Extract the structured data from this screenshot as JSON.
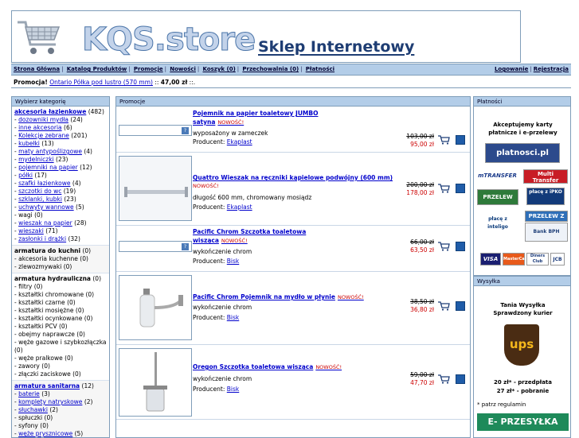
{
  "header": {
    "brand": "KQS.store",
    "tagline": "Sklep Internetowy"
  },
  "nav": {
    "items": [
      "Strona Główna",
      "Katalog Produktów",
      "Promocje",
      "Nowości",
      "Koszyk (0)",
      "Przechowalnia (0)",
      "Płatności"
    ],
    "right": [
      "Logowanie",
      "Rejestracja"
    ]
  },
  "promo_bar": {
    "label": "Promocja!",
    "link": "Ontario Półka pod lustro (570 mm)",
    "price": "47,00 zł"
  },
  "left": {
    "title": "Wybierz kategorię",
    "groups": [
      {
        "head": "akcesoria łazienkowe",
        "count": "(482)",
        "items": [
          {
            "name": "dozowniki mydła",
            "count": "(24)",
            "link": true
          },
          {
            "name": "inne akcesoria",
            "count": "(6)",
            "link": true
          },
          {
            "name": "Kolekcje zebrane",
            "count": "(201)",
            "link": true
          },
          {
            "name": "kubełki",
            "count": "(13)",
            "link": true
          },
          {
            "name": "maty antypoślizgowe",
            "count": "(4)",
            "link": true
          },
          {
            "name": "mydelniczki",
            "count": "(23)",
            "link": true
          },
          {
            "name": "pojemniki na papier",
            "count": "(12)",
            "link": true
          },
          {
            "name": "półki",
            "count": "(17)",
            "link": true
          },
          {
            "name": "szafki łazienkowe",
            "count": "(4)",
            "link": true
          },
          {
            "name": "szczotki do wc",
            "count": "(19)",
            "link": true
          },
          {
            "name": "szklanki, kubki",
            "count": "(23)",
            "link": true
          },
          {
            "name": "uchwyty wannowe",
            "count": "(5)",
            "link": true
          },
          {
            "name": "wagi",
            "count": "(0)",
            "link": false
          },
          {
            "name": "wieszak na papier",
            "count": "(28)",
            "link": true
          },
          {
            "name": "wieszaki",
            "count": "(71)",
            "link": true
          },
          {
            "name": "zasłonki i drążki",
            "count": "(32)",
            "link": true
          }
        ]
      },
      {
        "head": "armatura do kuchni",
        "count": "(0)",
        "items": [
          {
            "name": "akcesoria kuchenne",
            "count": "(0)",
            "link": false
          },
          {
            "name": "zlewozmywaki",
            "count": "(0)",
            "link": false
          }
        ]
      },
      {
        "head": "armatura hydrauliczna",
        "count": "(0)",
        "items": [
          {
            "name": "filtry",
            "count": "(0)",
            "link": false
          },
          {
            "name": "kształtki chromowane",
            "count": "(0)",
            "link": false
          },
          {
            "name": "kształtki czarne",
            "count": "(0)",
            "link": false
          },
          {
            "name": "kształtki mosiężne",
            "count": "(0)",
            "link": false
          },
          {
            "name": "kształtki ocynkowane",
            "count": "(0)",
            "link": false
          },
          {
            "name": "kształtki PCV",
            "count": "(0)",
            "link": false
          },
          {
            "name": "obejmy naprawcze",
            "count": "(0)",
            "link": false
          },
          {
            "name": "węże gazowe i szybkozłączka",
            "count": "(0)",
            "link": false
          },
          {
            "name": "węże pralkowe",
            "count": "(0)",
            "link": false
          },
          {
            "name": "zawory",
            "count": "(0)",
            "link": false
          },
          {
            "name": "złączki zaciskowe",
            "count": "(0)",
            "link": false
          }
        ]
      },
      {
        "head": "armatura sanitarna",
        "count": "(12)",
        "items": [
          {
            "name": "baterie",
            "count": "(3)",
            "link": true
          },
          {
            "name": "komplety natryskowe",
            "count": "(2)",
            "link": true
          },
          {
            "name": "słuchawki",
            "count": "(2)",
            "link": true
          },
          {
            "name": "spłuczki",
            "count": "(0)",
            "link": false
          },
          {
            "name": "syfony",
            "count": "(0)",
            "link": false
          },
          {
            "name": "węże prysznicowe",
            "count": "(5)",
            "link": true
          }
        ]
      }
    ]
  },
  "center": {
    "title": "Promocje",
    "products": [
      {
        "name": "Pojemnik na papier toaletowy JUMBO satyna",
        "new": "NOWOŚĆ!",
        "desc": "wyposażony w zameczek",
        "producer_label": "Producent:",
        "producer": "Ekaplast",
        "old": "103,00 zł",
        "price": "95,00 zł"
      },
      {
        "name": "Quattro Wieszak na ręczniki kąpielowe podwójny (600 mm)",
        "new": "NOWOŚĆ!",
        "desc": "długość 600 mm, chromowany mosiądz",
        "producer_label": "Producent:",
        "producer": "Ekaplast",
        "old": "200,00 zł",
        "price": "178,00 zł"
      },
      {
        "name": "Pacific Chrom Szczotka toaletowa wisząca",
        "new": "NOWOŚĆ!",
        "desc": "wykończenie chrom",
        "producer_label": "Producent:",
        "producer": "Bisk",
        "old": "66,00 zł",
        "price": "63,50 zł"
      },
      {
        "name": "Pacific Chrom Pojemnik na mydło w płynie",
        "new": "NOWOŚĆ!",
        "desc": "wykończenie chrom",
        "producer_label": "Producent:",
        "producer": "Bisk",
        "old": "38,50 zł",
        "price": "36,80 zł"
      },
      {
        "name": "Oregon Szczotka toaletowa wisząca",
        "new": "NOWOŚĆ!",
        "desc": "wykończenie chrom",
        "producer_label": "Producent:",
        "producer": "Bisk",
        "old": "59,00 zł",
        "price": "47,70 zł"
      }
    ]
  },
  "right": {
    "title": "Płatności",
    "text1": "Akceptujemy karty płatnicze i e-przelewy",
    "logos": [
      "platnosci.pl",
      "mTRANSFER",
      "Multi Transfer",
      "PRZELEW",
      "płacę z iPKO",
      "płacę z inteligo",
      "PRZELEW Z",
      "Bank BPH",
      "VISA",
      "MasterCard",
      "Diners Club",
      "JCB"
    ]
  },
  "right2": {
    "title": "Wysyłka",
    "text1": "Tania Wysyłka",
    "text2": "Sprawdzony kurier",
    "ups": "ups",
    "fee1": "20 zł* - przedpłata",
    "fee2": "27 zł* - pobranie",
    "note": "* patrz regulamin",
    "eprzesylka": "E- PRZESYŁKA"
  },
  "colors": {
    "accent": "#b3cde8",
    "border": "#7f9db9",
    "price": "#cc0000",
    "link": "#0000cc"
  }
}
